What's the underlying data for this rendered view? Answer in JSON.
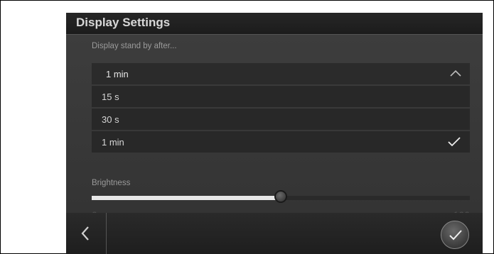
{
  "header": {
    "title": "Display Settings"
  },
  "standby": {
    "label": "Display stand by after...",
    "selected": "1 min",
    "options": [
      {
        "label": "15 s",
        "checked": false
      },
      {
        "label": "30 s",
        "checked": false
      },
      {
        "label": "1 min",
        "checked": true
      }
    ]
  },
  "brightness": {
    "label": "Brightness",
    "min": "0",
    "max": "100",
    "value": 50
  },
  "icons": {
    "dropdown": "chevron-up-icon",
    "selected": "checkmark-icon",
    "back": "chevron-left-icon",
    "confirm": "checkmark-icon"
  },
  "colors": {
    "header_bg": "#1c1c1c",
    "content_bg": "#3a3a3a",
    "slider_fill": "#e8e8e8"
  }
}
